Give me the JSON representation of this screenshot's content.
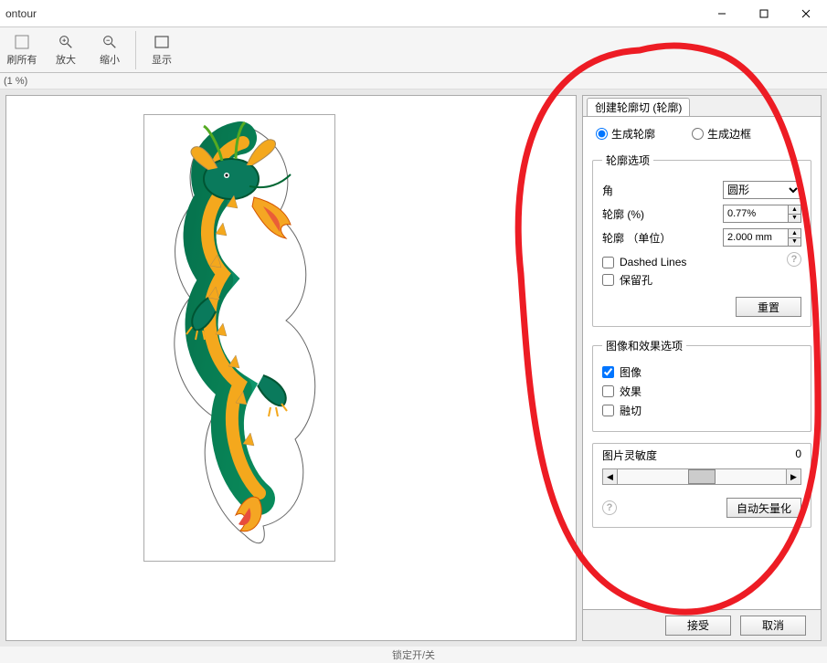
{
  "window": {
    "title": "ontour"
  },
  "toolbar": {
    "refresh_all": "刷所有",
    "zoom_in": "放大",
    "zoom_out": "缩小",
    "show": "显示"
  },
  "zoom_status": "(1 %)",
  "panel": {
    "tab_label": "创建轮廓切 (轮廓)",
    "radio_contour": "生成轮廓",
    "radio_border": "生成边框",
    "group_contour_options": "轮廓选项",
    "label_corner": "角",
    "corner_value": "圆形",
    "label_contour_pct": "轮廓 (%)",
    "contour_pct_value": "0.77%",
    "label_contour_unit": "轮廓 （单位）",
    "contour_unit_value": "2.000 mm",
    "check_dashed": "Dashed Lines",
    "check_keep_holes": "保留孔",
    "btn_reset": "重置",
    "group_image_effect": "图像和效果选项",
    "check_image": "图像",
    "check_effect": "效果",
    "check_melt": "融切",
    "label_sensitivity": "图片灵敏度",
    "sensitivity_value": "0",
    "btn_autovector": "自动矢量化"
  },
  "footer": {
    "accept": "接受",
    "cancel": "取消"
  },
  "status": "锁定开/关"
}
